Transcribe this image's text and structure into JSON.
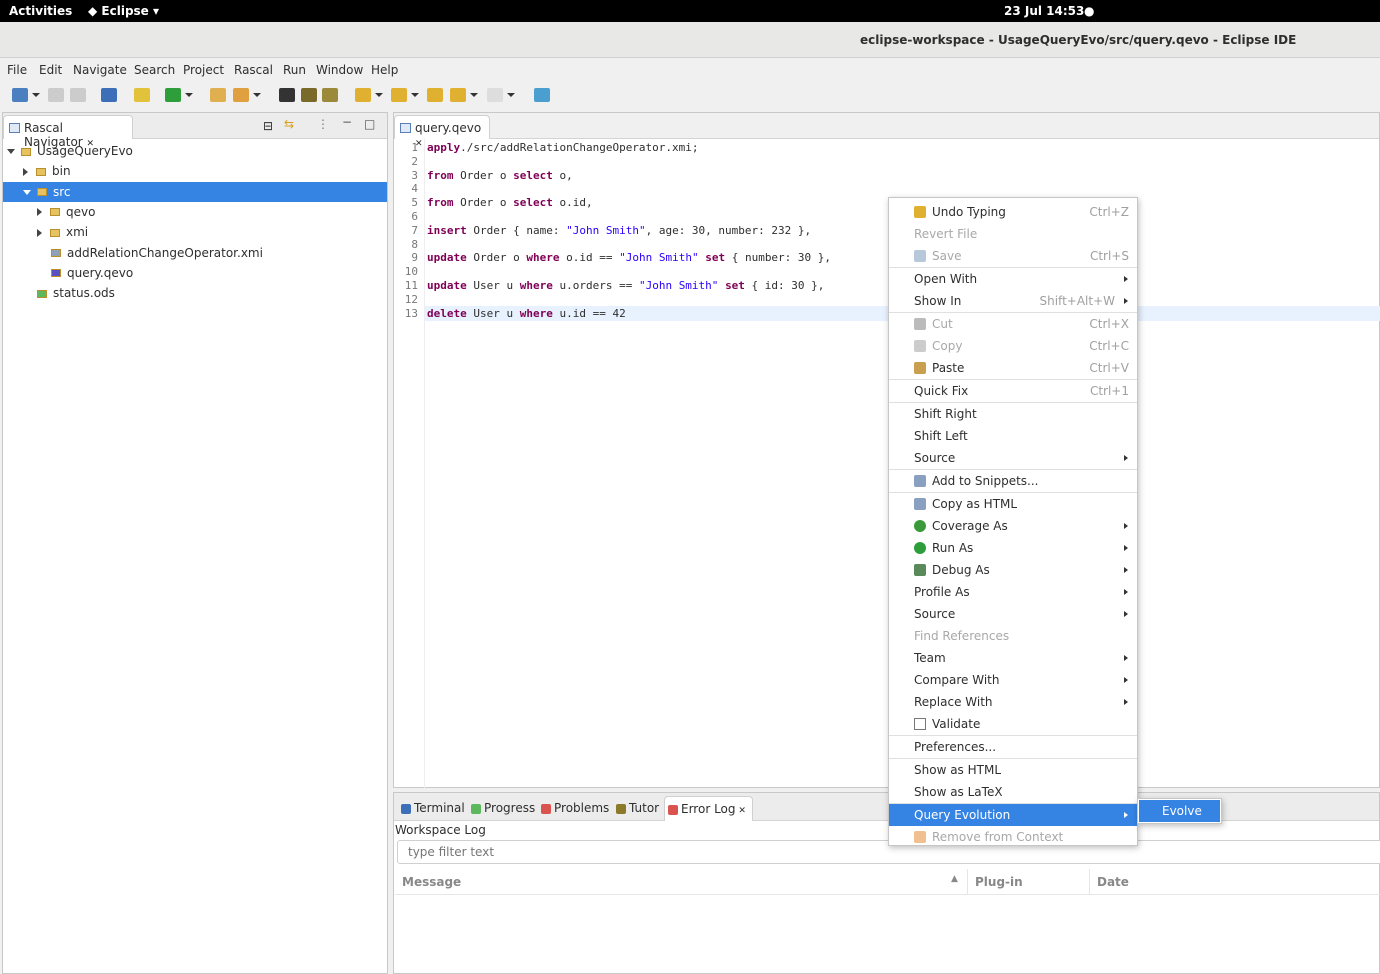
{
  "topbar": {
    "activities": "Activities",
    "app": "Eclipse",
    "clock": "23 Jul  14:53"
  },
  "window": {
    "title": "eclipse-workspace - UsageQueryEvo/src/query.qevo - Eclipse IDE"
  },
  "menubar": [
    "File",
    "Edit",
    "Navigate",
    "Search",
    "Project",
    "Rascal",
    "Run",
    "Window",
    "Help"
  ],
  "navigator": {
    "tab": "Rascal Navigator",
    "tree": [
      {
        "label": "UsageQueryEvo",
        "depth": 0,
        "expanded": true
      },
      {
        "label": "bin",
        "depth": 1,
        "expanded": false
      },
      {
        "label": "src",
        "depth": 1,
        "expanded": true,
        "selected": true
      },
      {
        "label": "qevo",
        "depth": 2,
        "expanded": false
      },
      {
        "label": "xmi",
        "depth": 2,
        "expanded": false
      },
      {
        "label": "addRelationChangeOperator.xmi",
        "depth": 2
      },
      {
        "label": "query.qevo",
        "depth": 2
      },
      {
        "label": "status.ods",
        "depth": 1
      }
    ]
  },
  "editor": {
    "tab": "query.qevo",
    "lines": [
      [
        [
          "kw",
          "apply"
        ],
        [
          "",
          "./src/addRelationChangeOperator.xmi;"
        ]
      ],
      [],
      [
        [
          "kw",
          "from"
        ],
        [
          "",
          " Order o "
        ],
        [
          "kw",
          "select"
        ],
        [
          "",
          " o,"
        ]
      ],
      [],
      [
        [
          "kw",
          "from"
        ],
        [
          "",
          " Order o "
        ],
        [
          "kw",
          "select"
        ],
        [
          "",
          " o.id,"
        ]
      ],
      [],
      [
        [
          "kw",
          "insert"
        ],
        [
          "",
          " Order { name: "
        ],
        [
          "str",
          "\"John Smith\""
        ],
        [
          "",
          ", age: 30, number: 232 },"
        ]
      ],
      [],
      [
        [
          "kw",
          "update"
        ],
        [
          "",
          " Order o "
        ],
        [
          "kw",
          "where"
        ],
        [
          "",
          " o.id == "
        ],
        [
          "str",
          "\"John Smith\""
        ],
        [
          "",
          " "
        ],
        [
          "kw",
          "set"
        ],
        [
          "",
          " { number: 30 },"
        ]
      ],
      [],
      [
        [
          "kw",
          "update"
        ],
        [
          "",
          " User u "
        ],
        [
          "kw",
          "where"
        ],
        [
          "",
          " u.orders == "
        ],
        [
          "str",
          "\"John Smith\""
        ],
        [
          "",
          " "
        ],
        [
          "kw",
          "set"
        ],
        [
          "",
          " { id: 30 },"
        ]
      ],
      [],
      [
        [
          "kw",
          "delete"
        ],
        [
          "",
          " User u "
        ],
        [
          "kw",
          "where"
        ],
        [
          "",
          " u.id == 42"
        ]
      ]
    ]
  },
  "bottom": {
    "tabs": [
      "Terminal",
      "Progress",
      "Problems",
      "Tutor",
      "Error Log"
    ],
    "active": "Error Log",
    "heading": "Workspace Log",
    "filter_placeholder": "type filter text",
    "columns": [
      "Message",
      "Plug-in",
      "Date"
    ]
  },
  "context_menu": {
    "items": [
      {
        "label": "Undo Typing",
        "shortcut": "Ctrl+Z",
        "icon": "undo-icon"
      },
      {
        "label": "Revert File",
        "disabled": true
      },
      {
        "label": "Save",
        "shortcut": "Ctrl+S",
        "disabled": true,
        "icon": "save-icon"
      },
      {
        "sep": true
      },
      {
        "label": "Open With",
        "submenu": true
      },
      {
        "label": "Show In",
        "shortcut": "Shift+Alt+W",
        "submenu": true
      },
      {
        "sep": true
      },
      {
        "label": "Cut",
        "shortcut": "Ctrl+X",
        "disabled": true,
        "icon": "cut-icon"
      },
      {
        "label": "Copy",
        "shortcut": "Ctrl+C",
        "disabled": true,
        "icon": "copy-icon"
      },
      {
        "label": "Paste",
        "shortcut": "Ctrl+V",
        "icon": "paste-icon"
      },
      {
        "sep": true
      },
      {
        "label": "Quick Fix",
        "shortcut": "Ctrl+1"
      },
      {
        "sep": true
      },
      {
        "label": "Shift Right"
      },
      {
        "label": "Shift Left"
      },
      {
        "label": "Source",
        "submenu": true
      },
      {
        "sep": true
      },
      {
        "label": "Add to Snippets...",
        "icon": "snippet-icon"
      },
      {
        "sep": true
      },
      {
        "label": "Copy as HTML",
        "icon": "copy-html-icon"
      },
      {
        "label": "Coverage As",
        "submenu": true,
        "icon": "coverage-icon"
      },
      {
        "label": "Run As",
        "submenu": true,
        "icon": "run-icon"
      },
      {
        "label": "Debug As",
        "submenu": true,
        "icon": "debug-icon"
      },
      {
        "label": "Profile As",
        "submenu": true
      },
      {
        "label": "Source",
        "submenu": true
      },
      {
        "label": "Find References",
        "disabled": true
      },
      {
        "label": "Team",
        "submenu": true
      },
      {
        "label": "Compare With",
        "submenu": true
      },
      {
        "label": "Replace With",
        "submenu": true
      },
      {
        "label": "Validate",
        "icon": "checkbox-icon"
      },
      {
        "sep": true
      },
      {
        "label": "Preferences..."
      },
      {
        "sep": true
      },
      {
        "label": "Show as HTML"
      },
      {
        "label": "Show as LaTeX"
      },
      {
        "sep": true
      },
      {
        "label": "Query Evolution",
        "submenu": true,
        "selected": true
      },
      {
        "label": "Remove from Context",
        "disabled": true,
        "icon": "remove-context-icon"
      }
    ],
    "submenu": {
      "items": [
        "Evolve"
      ]
    }
  },
  "colors": {
    "selection": "#3584e4",
    "keyword": "#7f0055",
    "string": "#2a00ff",
    "current_line": "#e8f2fe"
  }
}
